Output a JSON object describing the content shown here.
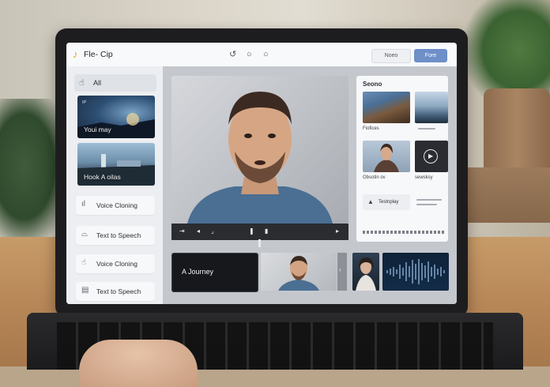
{
  "app": {
    "title": "Fle- Cip",
    "logo_icon": "music-note-icon"
  },
  "topbar": {
    "icons": [
      "undo-icon",
      "circle-icon",
      "circle-icon"
    ],
    "secondary_button": "Noeo",
    "primary_button": "Fore"
  },
  "sidebar": {
    "all_label": "All",
    "thumbnails": [
      {
        "small_text": "IP",
        "caption": "Youi may"
      },
      {
        "caption": "Hook A oilas"
      }
    ],
    "items": [
      {
        "label": "Voice Cloning",
        "icon": "sound-wave-icon"
      },
      {
        "label": "Text to Speech",
        "icon": "speech-icon"
      },
      {
        "label": "Voice Cloning",
        "icon": "hand-icon"
      },
      {
        "label": "Text to Speech",
        "icon": "document-icon"
      }
    ]
  },
  "right_panel": {
    "title": "Seono",
    "items": [
      {
        "label": "Fiofices"
      },
      {
        "label": ""
      },
      {
        "label": "Obsotin ov"
      },
      {
        "label": "sewsksy"
      }
    ],
    "action_label": "Testnplay"
  },
  "bottom_strip": {
    "clip_label": "A Journey"
  },
  "colors": {
    "accent": "#6e8fc8",
    "logo": "#e0a21f",
    "transport_bg": "#2a2c30"
  }
}
